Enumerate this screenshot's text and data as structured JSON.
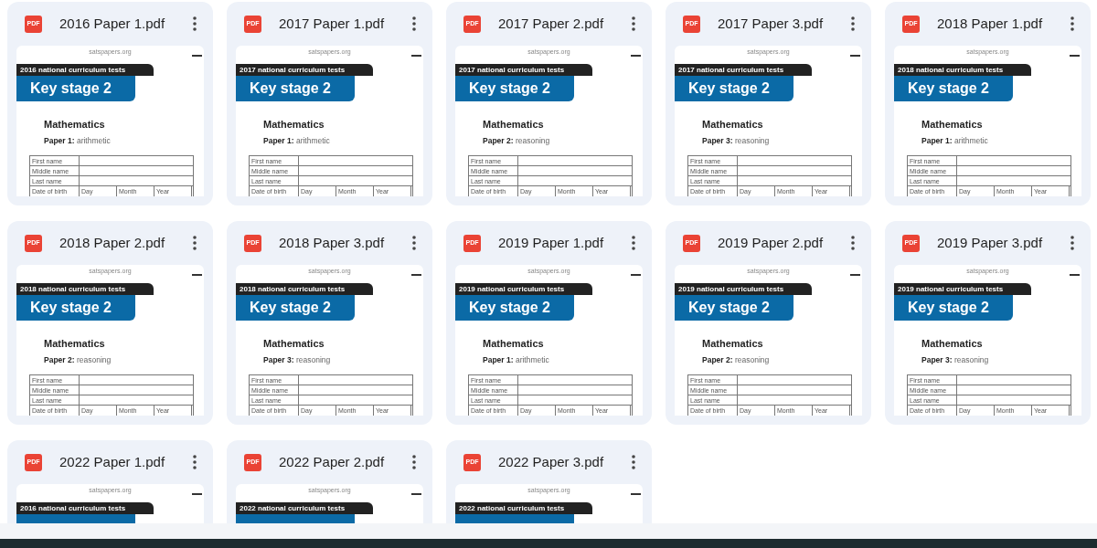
{
  "files": [
    {
      "type_label": "PDF",
      "name": "2016 Paper 1.pdf",
      "thumbnail": {
        "site": "satspapers.org",
        "series": "2016 national curriculum tests",
        "title": "Key stage 2",
        "subject": "Mathematics",
        "paper": "**Paper 1:** arithmetic",
        "form": [
          "First name",
          "Middle name",
          "Last name"
        ],
        "date_row": [
          "Date of birth",
          "Day",
          "Month",
          "Year"
        ]
      }
    },
    {
      "type_label": "PDF",
      "name": "2017 Paper 1.pdf",
      "thumbnail": {
        "site": "satspapers.org",
        "series": "2017 national curriculum tests",
        "title": "Key stage 2",
        "subject": "Mathematics",
        "paper": "**Paper 1:** arithmetic",
        "form": [
          "First name",
          "Middle name",
          "Last name"
        ],
        "date_row": [
          "Date of birth",
          "Day",
          "Month",
          "Year"
        ]
      }
    },
    {
      "type_label": "PDF",
      "name": "2017 Paper 2.pdf",
      "thumbnail": {
        "site": "satspapers.org",
        "series": "2017 national curriculum tests",
        "title": "Key stage 2",
        "subject": "Mathematics",
        "paper": "**Paper 2:** reasoning",
        "form": [
          "First name",
          "Middle name",
          "Last name"
        ],
        "date_row": [
          "Date of birth",
          "Day",
          "Month",
          "Year"
        ]
      }
    },
    {
      "type_label": "PDF",
      "name": "2017 Paper 3.pdf",
      "thumbnail": {
        "site": "satspapers.org",
        "series": "2017 national curriculum tests",
        "title": "Key stage 2",
        "subject": "Mathematics",
        "paper": "**Paper 3:** reasoning",
        "form": [
          "First name",
          "Middle name",
          "Last name"
        ],
        "date_row": [
          "Date of birth",
          "Day",
          "Month",
          "Year"
        ]
      }
    },
    {
      "type_label": "PDF",
      "name": "2018 Paper 1.pdf",
      "thumbnail": {
        "site": "satspapers.org",
        "series": "2018 national curriculum tests",
        "title": "Key stage 2",
        "subject": "Mathematics",
        "paper": "**Paper 1:** arithmetic",
        "form": [
          "First name",
          "Middle name",
          "Last name"
        ],
        "date_row": [
          "Date of birth",
          "Day",
          "Month",
          "Year"
        ]
      }
    },
    {
      "type_label": "PDF",
      "name": "2018 Paper 2.pdf",
      "thumbnail": {
        "site": "satspapers.org",
        "series": "2018 national curriculum tests",
        "title": "Key stage 2",
        "subject": "Mathematics",
        "paper": "**Paper 2:** reasoning",
        "form": [
          "First name",
          "Middle name",
          "Last name"
        ],
        "date_row": [
          "Date of birth",
          "Day",
          "Month",
          "Year"
        ]
      }
    },
    {
      "type_label": "PDF",
      "name": "2018 Paper 3.pdf",
      "thumbnail": {
        "site": "satspapers.org",
        "series": "2018 national curriculum tests",
        "title": "Key stage 2",
        "subject": "Mathematics",
        "paper": "**Paper 3:** reasoning",
        "form": [
          "First name",
          "Middle name",
          "Last name"
        ],
        "date_row": [
          "Date of birth",
          "Day",
          "Month",
          "Year"
        ]
      }
    },
    {
      "type_label": "PDF",
      "name": "2019 Paper 1.pdf",
      "thumbnail": {
        "site": "satspapers.org",
        "series": "2019 national curriculum tests",
        "title": "Key stage 2",
        "subject": "Mathematics",
        "paper": "**Paper 1:** arithmetic",
        "form": [
          "First name",
          "Middle name",
          "Last name"
        ],
        "date_row": [
          "Date of birth",
          "Day",
          "Month",
          "Year"
        ]
      }
    },
    {
      "type_label": "PDF",
      "name": "2019 Paper 2.pdf",
      "thumbnail": {
        "site": "satspapers.org",
        "series": "2019 national curriculum tests",
        "title": "Key stage 2",
        "subject": "Mathematics",
        "paper": "**Paper 2:** reasoning",
        "form": [
          "First name",
          "Middle name",
          "Last name"
        ],
        "date_row": [
          "Date of birth",
          "Day",
          "Month",
          "Year"
        ]
      }
    },
    {
      "type_label": "PDF",
      "name": "2019 Paper 3.pdf",
      "thumbnail": {
        "site": "satspapers.org",
        "series": "2019 national curriculum tests",
        "title": "Key stage 2",
        "subject": "Mathematics",
        "paper": "**Paper 3:** reasoning",
        "form": [
          "First name",
          "Middle name",
          "Last name"
        ],
        "date_row": [
          "Date of birth",
          "Day",
          "Month",
          "Year"
        ]
      }
    },
    {
      "type_label": "PDF",
      "name": "2022 Paper 1.pdf",
      "thumbnail": {
        "site": "satspapers.org",
        "series": "2016 national curriculum tests"
      }
    },
    {
      "type_label": "PDF",
      "name": "2022 Paper 2.pdf",
      "thumbnail": {
        "site": "satspapers.org",
        "series": "2022 national curriculum tests"
      }
    },
    {
      "type_label": "PDF",
      "name": "2022 Paper 3.pdf",
      "thumbnail": {
        "site": "satspapers.org",
        "series": "2022 national curriculum tests"
      }
    }
  ]
}
